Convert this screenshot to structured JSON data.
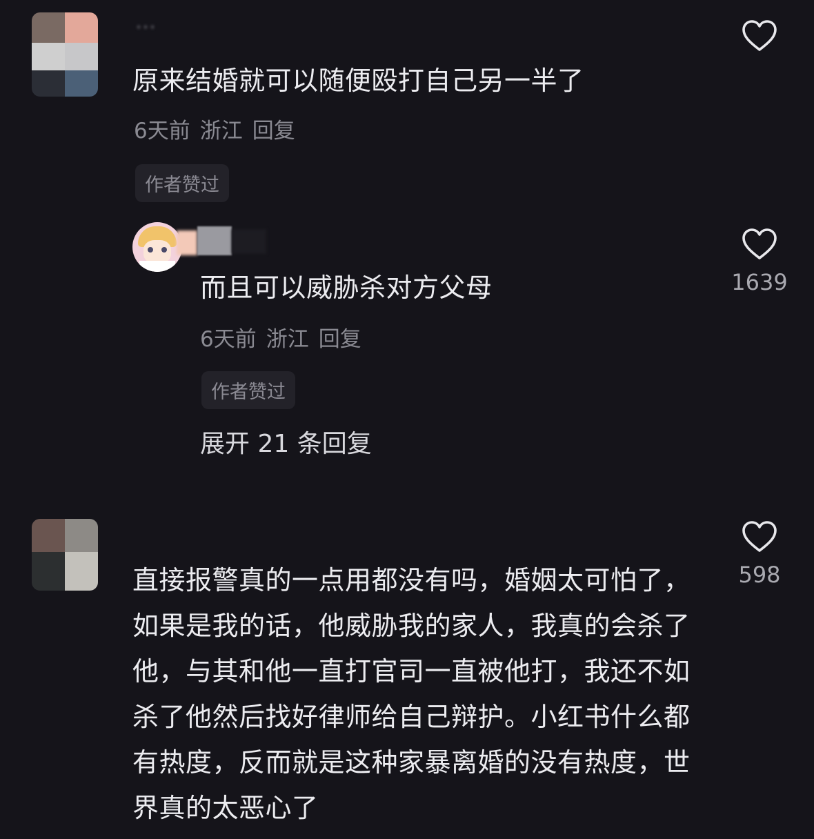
{
  "comments": [
    {
      "username": "…",
      "text": "原来结婚就可以随便殴打自己另一半了",
      "meta": {
        "time": "6天前",
        "location": "浙江",
        "reply": "回复"
      },
      "badge": "作者赞过",
      "likes": ""
    },
    {
      "username": "",
      "text": "而且可以威胁杀对方父母",
      "meta": {
        "time": "6天前",
        "location": "浙江",
        "reply": "回复"
      },
      "badge": "作者赞过",
      "likes": "1639"
    },
    {
      "username": "",
      "text": "直接报警真的一点用都没有吗，婚姻太可怕了，如果是我的话，他威胁我的家人，我真的会杀了他，与其和他一直打官司一直被他打，我还不如杀了他然后找好律师给自己辩护。小红书什么都有热度，反而就是这种家暴离婚的没有热度，世界真的太恶心了",
      "likes": "598"
    }
  ],
  "expand_replies": "展开 21 条回复",
  "icons": {
    "like": "heart-outline-icon"
  },
  "colors": {
    "background": "#15141a",
    "text": "#ececf0",
    "meta": "#8a8a92",
    "badge_bg": "#232229"
  }
}
